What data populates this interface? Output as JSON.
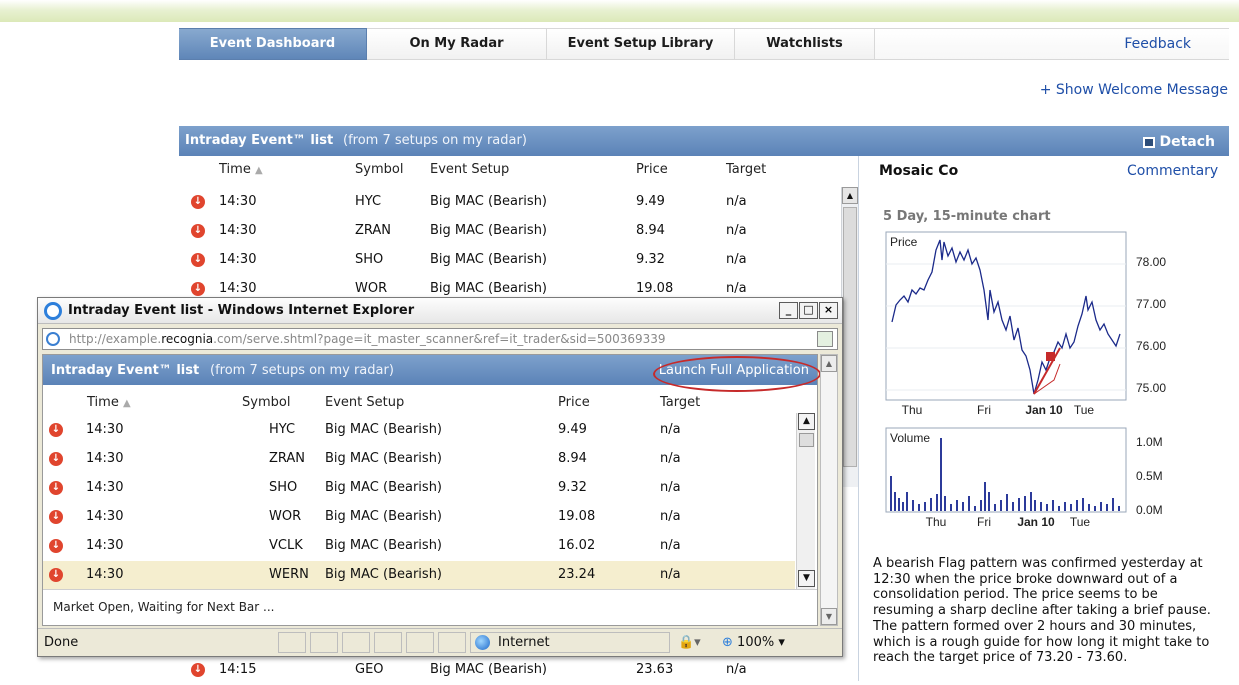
{
  "tabs": [
    {
      "label": "Event Dashboard",
      "active": true
    },
    {
      "label": "On My Radar"
    },
    {
      "label": "Event Setup Library"
    },
    {
      "label": "Watchlists"
    }
  ],
  "feedback": "Feedback",
  "welcome": "+ Show Welcome Message",
  "main": {
    "title": "Intraday Event™ list",
    "subtitle": "(from 7 setups on my radar)",
    "detach": "Detach",
    "columns": {
      "time": "Time",
      "symbol": "Symbol",
      "setup": "Event Setup",
      "price": "Price",
      "target": "Target"
    },
    "rows": [
      {
        "time": "14:30",
        "symbol": "HYC",
        "setup": "Big MAC (Bearish)",
        "price": "9.49",
        "target": "n/a"
      },
      {
        "time": "14:30",
        "symbol": "ZRAN",
        "setup": "Big MAC (Bearish)",
        "price": "8.94",
        "target": "n/a"
      },
      {
        "time": "14:30",
        "symbol": "SHO",
        "setup": "Big MAC (Bearish)",
        "price": "9.32",
        "target": "n/a"
      },
      {
        "time": "14:30",
        "symbol": "WOR",
        "setup": "Big MAC (Bearish)",
        "price": "19.08",
        "target": "n/a"
      }
    ],
    "last_row": {
      "time": "14:15",
      "symbol": "GEO",
      "setup": "Big MAC (Bearish)",
      "price": "23.63",
      "target": "n/a"
    }
  },
  "right": {
    "company": "Mosaic Co",
    "commentary": "Commentary",
    "chart_label": "5 Day, 15-minute chart",
    "price_label": "Price",
    "price_ticks": [
      "78.00",
      "77.00",
      "76.00",
      "75.00"
    ],
    "volume_label": "Volume",
    "volume_ticks": [
      "1.0M",
      "0.5M",
      "0.0M"
    ],
    "days": [
      "Thu",
      "Fri",
      "Jan 10",
      "Tue"
    ],
    "description": "A bearish Flag pattern was confirmed yesterday at 12:30 when the price broke downward out of a consolidation period. The price seems to be resuming a sharp decline after taking a brief pause. The pattern formed over 2 hours and 30 minutes, which is a rough guide for how long it might take to reach the target price of 73.20 - 73.60."
  },
  "popup": {
    "title": "Intraday Event list - Windows Internet Explorer",
    "url_pre": "http://example.",
    "url_host": "recognia",
    "url_post": ".com/serve.shtml?page=it_master_scanner&ref=it_trader&sid=500369339",
    "panel_title": "Intraday Event™ list",
    "panel_subtitle": "(from 7 setups on my radar)",
    "launch": "Launch Full Application",
    "columns": {
      "time": "Time",
      "symbol": "Symbol",
      "setup": "Event Setup",
      "price": "Price",
      "target": "Target"
    },
    "rows": [
      {
        "time": "14:30",
        "symbol": "HYC",
        "setup": "Big MAC (Bearish)",
        "price": "9.49",
        "target": "n/a"
      },
      {
        "time": "14:30",
        "symbol": "ZRAN",
        "setup": "Big MAC (Bearish)",
        "price": "8.94",
        "target": "n/a"
      },
      {
        "time": "14:30",
        "symbol": "SHO",
        "setup": "Big MAC (Bearish)",
        "price": "9.32",
        "target": "n/a"
      },
      {
        "time": "14:30",
        "symbol": "WOR",
        "setup": "Big MAC (Bearish)",
        "price": "19.08",
        "target": "n/a"
      },
      {
        "time": "14:30",
        "symbol": "VCLK",
        "setup": "Big MAC (Bearish)",
        "price": "16.02",
        "target": "n/a"
      },
      {
        "time": "14:30",
        "symbol": "WERN",
        "setup": "Big MAC (Bearish)",
        "price": "23.24",
        "target": "n/a"
      }
    ],
    "status_msg": "Market Open, Waiting for Next Bar ...",
    "status_done": "Done",
    "zone": "Internet",
    "zoom": "100%"
  },
  "colors": {
    "header_blue": "#5b83b7",
    "bear_red": "#e0452e",
    "link_blue": "#1f4fa8",
    "highlight": "#f5eecf"
  }
}
